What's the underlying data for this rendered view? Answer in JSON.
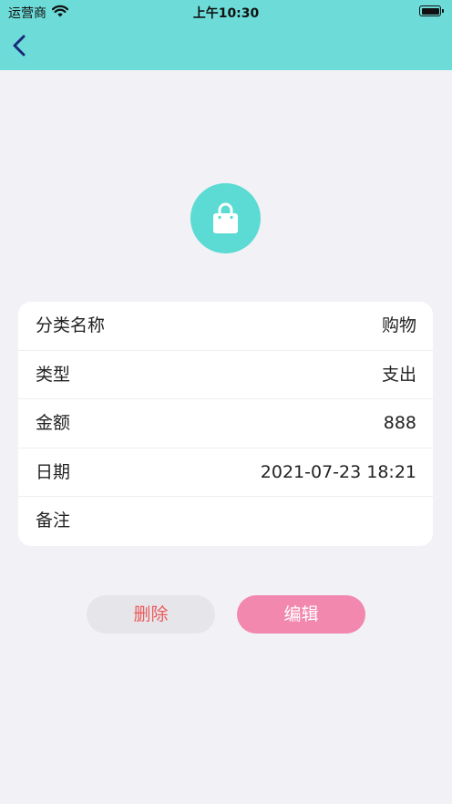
{
  "status_bar": {
    "carrier": "运营商",
    "time": "上午10:30"
  },
  "colors": {
    "header": "#6ddcd8",
    "icon_circle": "#5bdbd3",
    "delete_text": "#ec5b5b",
    "edit_bg": "#f288ad"
  },
  "category_icon": "shopping-bag-icon",
  "details": [
    {
      "label": "分类名称",
      "value": "购物"
    },
    {
      "label": "类型",
      "value": "支出"
    },
    {
      "label": "金额",
      "value": "888"
    },
    {
      "label": "日期",
      "value": "2021-07-23 18:21"
    },
    {
      "label": "备注",
      "value": ""
    }
  ],
  "actions": {
    "delete_label": "删除",
    "edit_label": "编辑"
  }
}
